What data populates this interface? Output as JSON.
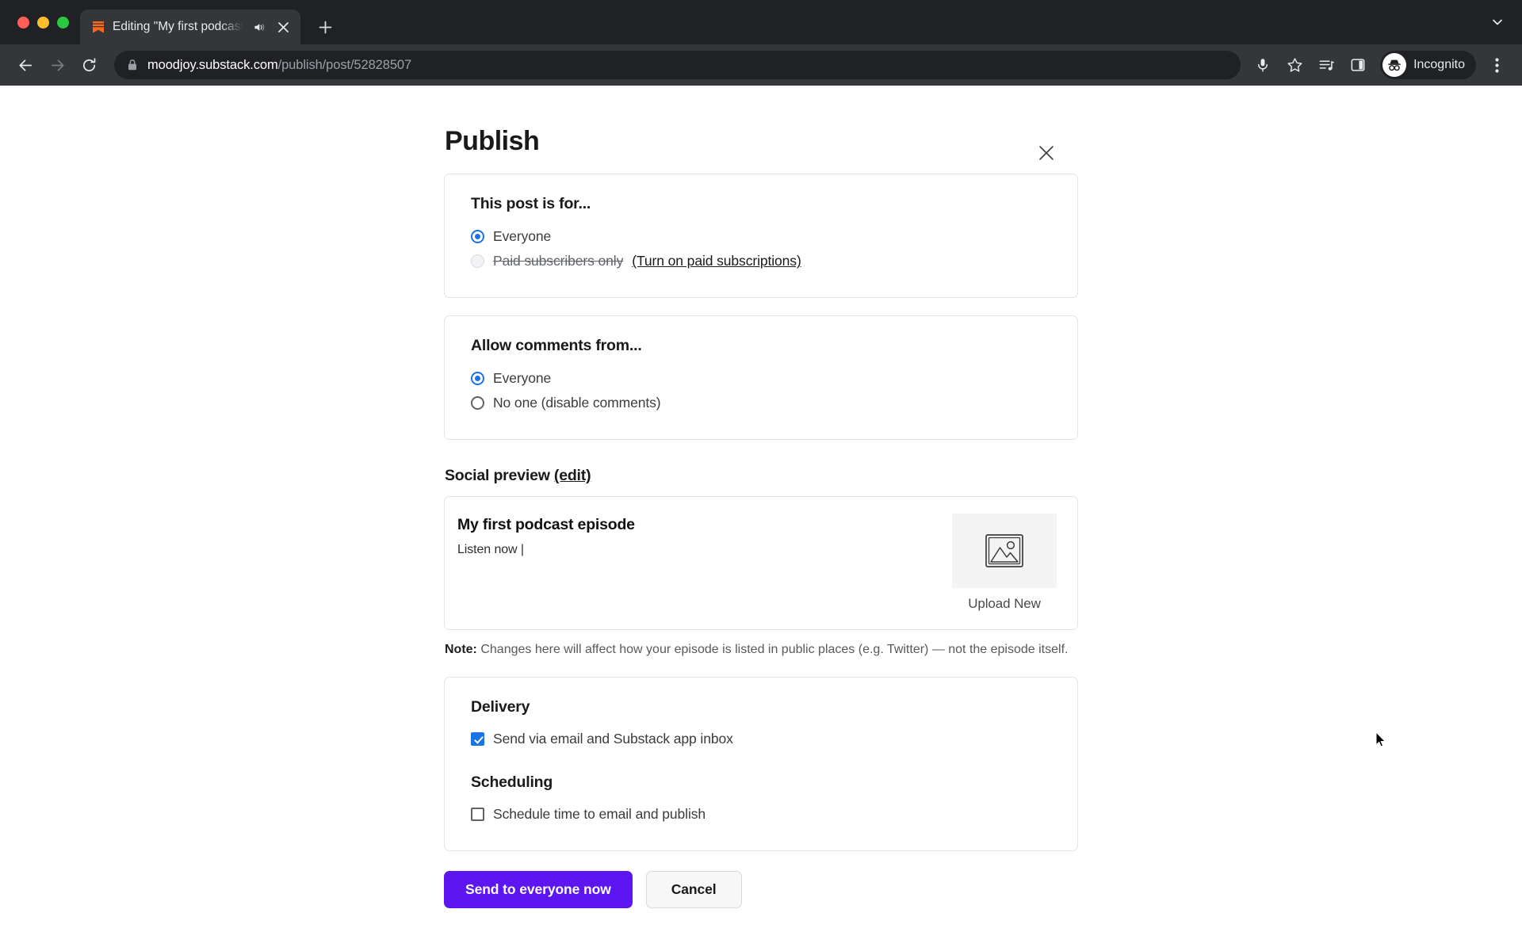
{
  "browser": {
    "traffic_lights": [
      "close",
      "minimize",
      "zoom"
    ],
    "tab": {
      "favicon": "substack-bookmark-icon",
      "title": "Editing \"My first podcast e",
      "audio_icon": "speaker-playing-icon",
      "close_icon": "close-icon"
    },
    "new_tab_label": "+",
    "tab_list_chevron": "chevron-down-icon",
    "nav": {
      "back": "back-arrow-icon",
      "forward": "forward-arrow-icon",
      "reload": "reload-icon"
    },
    "omnibox": {
      "lock_icon": "lock-icon",
      "host": "moodjoy.substack.com",
      "path": "/publish/post/52828507"
    },
    "toolbar_icons": [
      "microphone-icon",
      "bookmark-star-icon",
      "media-playlist-icon",
      "side-panel-icon"
    ],
    "profile": {
      "avatar_icon": "incognito-icon",
      "label": "Incognito"
    },
    "menu_icon": "kebab-menu-icon"
  },
  "modal": {
    "title": "Publish",
    "close_icon": "close-icon",
    "audience": {
      "heading": "This post is for...",
      "options": [
        {
          "label": "Everyone",
          "selected": true,
          "disabled": false
        },
        {
          "label": "Paid subscribers only",
          "selected": false,
          "disabled": true,
          "link": "(Turn on paid subscriptions)"
        }
      ]
    },
    "comments": {
      "heading": "Allow comments from...",
      "options": [
        {
          "label": "Everyone",
          "selected": true
        },
        {
          "label": "No one (disable comments)",
          "selected": false
        }
      ]
    },
    "social_preview": {
      "heading": "Social preview",
      "edit_label": "(edit)",
      "preview_title": "My first podcast episode",
      "preview_subtitle": "Listen now |",
      "image_placeholder_icon": "image-placeholder-icon",
      "upload_label": "Upload New",
      "note_prefix": "Note:",
      "note_body": " Changes here will affect how your episode is listed in public places (e.g. Twitter) — not the episode itself."
    },
    "delivery": {
      "heading": "Delivery",
      "checkbox_label": "Send via email and Substack app inbox",
      "checked": true
    },
    "scheduling": {
      "heading": "Scheduling",
      "checkbox_label": "Schedule time to email and publish",
      "checked": false
    },
    "footer": {
      "primary_label": "Send to everyone now",
      "secondary_label": "Cancel"
    }
  },
  "colors": {
    "primary_button": "#5d16f0",
    "radio_accent": "#1a73e8",
    "chrome_dark": "#202124",
    "chrome_toolbar": "#35363a",
    "substack_orange": "#ff6719"
  }
}
